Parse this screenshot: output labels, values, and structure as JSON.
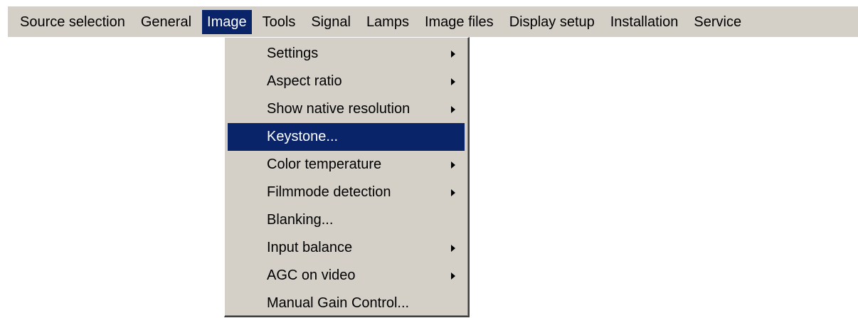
{
  "menubar": {
    "items": [
      {
        "label": "Source selection",
        "active": false
      },
      {
        "label": "General",
        "active": false
      },
      {
        "label": "Image",
        "active": true
      },
      {
        "label": "Tools",
        "active": false
      },
      {
        "label": "Signal",
        "active": false
      },
      {
        "label": "Lamps",
        "active": false
      },
      {
        "label": "Image files",
        "active": false
      },
      {
        "label": "Display setup",
        "active": false
      },
      {
        "label": "Installation",
        "active": false
      },
      {
        "label": "Service",
        "active": false
      }
    ]
  },
  "image_menu": {
    "items": [
      {
        "label": "Settings",
        "has_submenu": true,
        "highlighted": false
      },
      {
        "label": "Aspect ratio",
        "has_submenu": true,
        "highlighted": false
      },
      {
        "label": "Show native resolution",
        "has_submenu": true,
        "highlighted": false
      },
      {
        "label": "Keystone...",
        "has_submenu": false,
        "highlighted": true
      },
      {
        "label": "Color temperature",
        "has_submenu": true,
        "highlighted": false
      },
      {
        "label": "Filmmode detection",
        "has_submenu": true,
        "highlighted": false
      },
      {
        "label": "Blanking...",
        "has_submenu": false,
        "highlighted": false
      },
      {
        "label": "Input balance",
        "has_submenu": true,
        "highlighted": false
      },
      {
        "label": "AGC on video",
        "has_submenu": true,
        "highlighted": false
      },
      {
        "label": "Manual Gain Control...",
        "has_submenu": false,
        "highlighted": false
      }
    ]
  },
  "colors": {
    "menu_background": "#d4d0c8",
    "highlight": "#0a246a",
    "highlight_text": "#ffffff"
  }
}
